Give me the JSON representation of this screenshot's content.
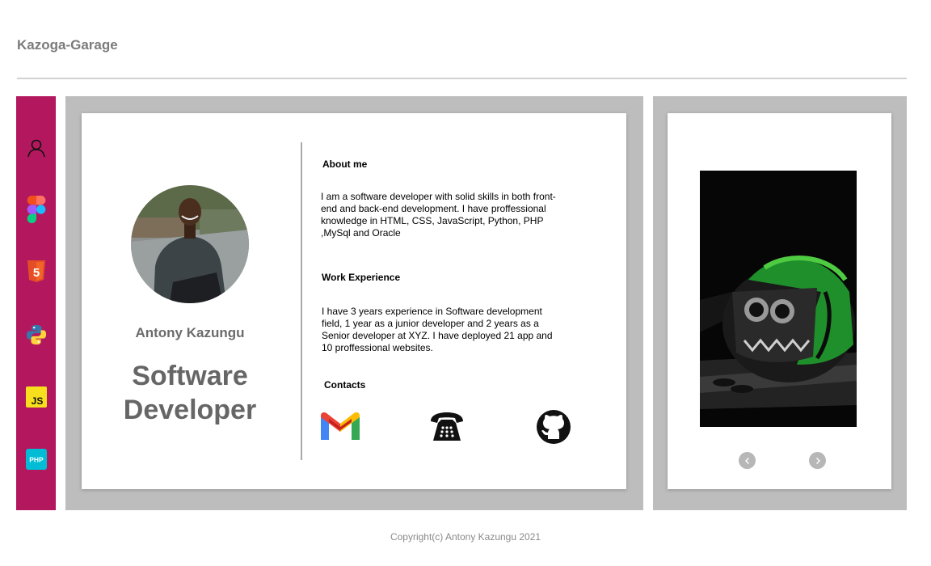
{
  "brand": "Kazoga-Garage",
  "sidebar": {
    "icons": [
      {
        "name": "user-icon"
      },
      {
        "name": "figma-icon"
      },
      {
        "name": "html5-icon",
        "label": "5"
      },
      {
        "name": "python-icon"
      },
      {
        "name": "javascript-icon",
        "label": "JS"
      },
      {
        "name": "php-icon",
        "label": "PHP"
      }
    ]
  },
  "profile": {
    "name": "Antony Kazungu",
    "role_line1": "Software",
    "role_line2": "Developer"
  },
  "about": {
    "title": "About me",
    "text": "I am a software developer with solid skills in both front-end and back-end development. I have proffessional knowledge in HTML, CSS, JavaScript, Python, PHP ,MySql and Oracle"
  },
  "work": {
    "title": "Work Experience",
    "text": "I have 3 years experience in Software development field, 1 year as a junior developer and 2 years as a Senior developer at XYZ. I have deployed 21 app and 10 proffessional websites."
  },
  "contacts": {
    "title": "Contacts",
    "items": [
      "gmail-icon",
      "telephone-icon",
      "github-icon"
    ]
  },
  "colors": {
    "sidebar": "#b3185e",
    "panel": "#bdbdbd",
    "muted_text": "#7b7b7b"
  },
  "footer": "Copyright(c) Antony Kazungu 2021"
}
